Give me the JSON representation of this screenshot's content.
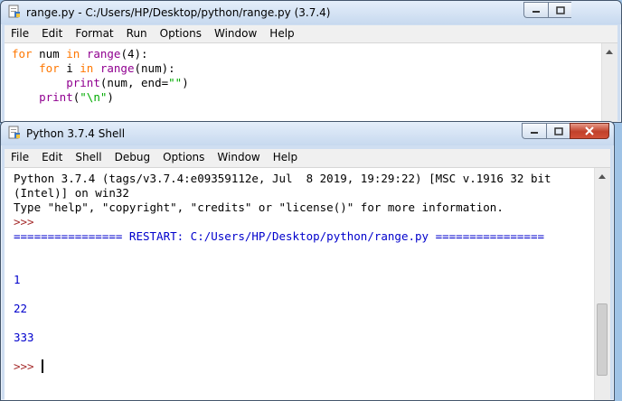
{
  "editor": {
    "title": "range.py - C:/Users/HP/Desktop/python/range.py (3.7.4)",
    "menu": [
      "File",
      "Edit",
      "Format",
      "Run",
      "Options",
      "Window",
      "Help"
    ],
    "code": {
      "l1": {
        "kw_for": "for",
        "a": " num ",
        "kw_in": "in",
        "b": " ",
        "fn_range": "range",
        "c": "(4):"
      },
      "l2": {
        "a": "    ",
        "kw_for": "for",
        "b": " i ",
        "kw_in": "in",
        "c": " ",
        "fn_range": "range",
        "d": "(num):"
      },
      "l3": {
        "a": "        ",
        "fn_print": "print",
        "b": "(num, end=",
        "s": "\"\"",
        "c": ")"
      },
      "l4": {
        "a": "    ",
        "fn_print": "print",
        "b": "(",
        "s": "\"\\n\"",
        "c": ")"
      }
    }
  },
  "shell": {
    "title": "Python 3.7.4 Shell",
    "menu": [
      "File",
      "Edit",
      "Shell",
      "Debug",
      "Options",
      "Window",
      "Help"
    ],
    "banner1": "Python 3.7.4 (tags/v3.7.4:e09359112e, Jul  8 2019, 19:29:22) [MSC v.1916 32 bit",
    "banner2": "(Intel)] on win32",
    "banner3": "Type \"help\", \"copyright\", \"credits\" or \"license()\" for more information.",
    "prompt1": ">>>",
    "restart": "================ RESTART: C:/Users/HP/Desktop/python/range.py ================",
    "outputs": [
      "1",
      "22",
      "333"
    ],
    "prompt2": ">>> "
  },
  "icons": [
    "idle-file-icon",
    "minimize-icon",
    "maximize-icon",
    "close-icon",
    "scroll-up-icon",
    "scroll-down-icon"
  ]
}
